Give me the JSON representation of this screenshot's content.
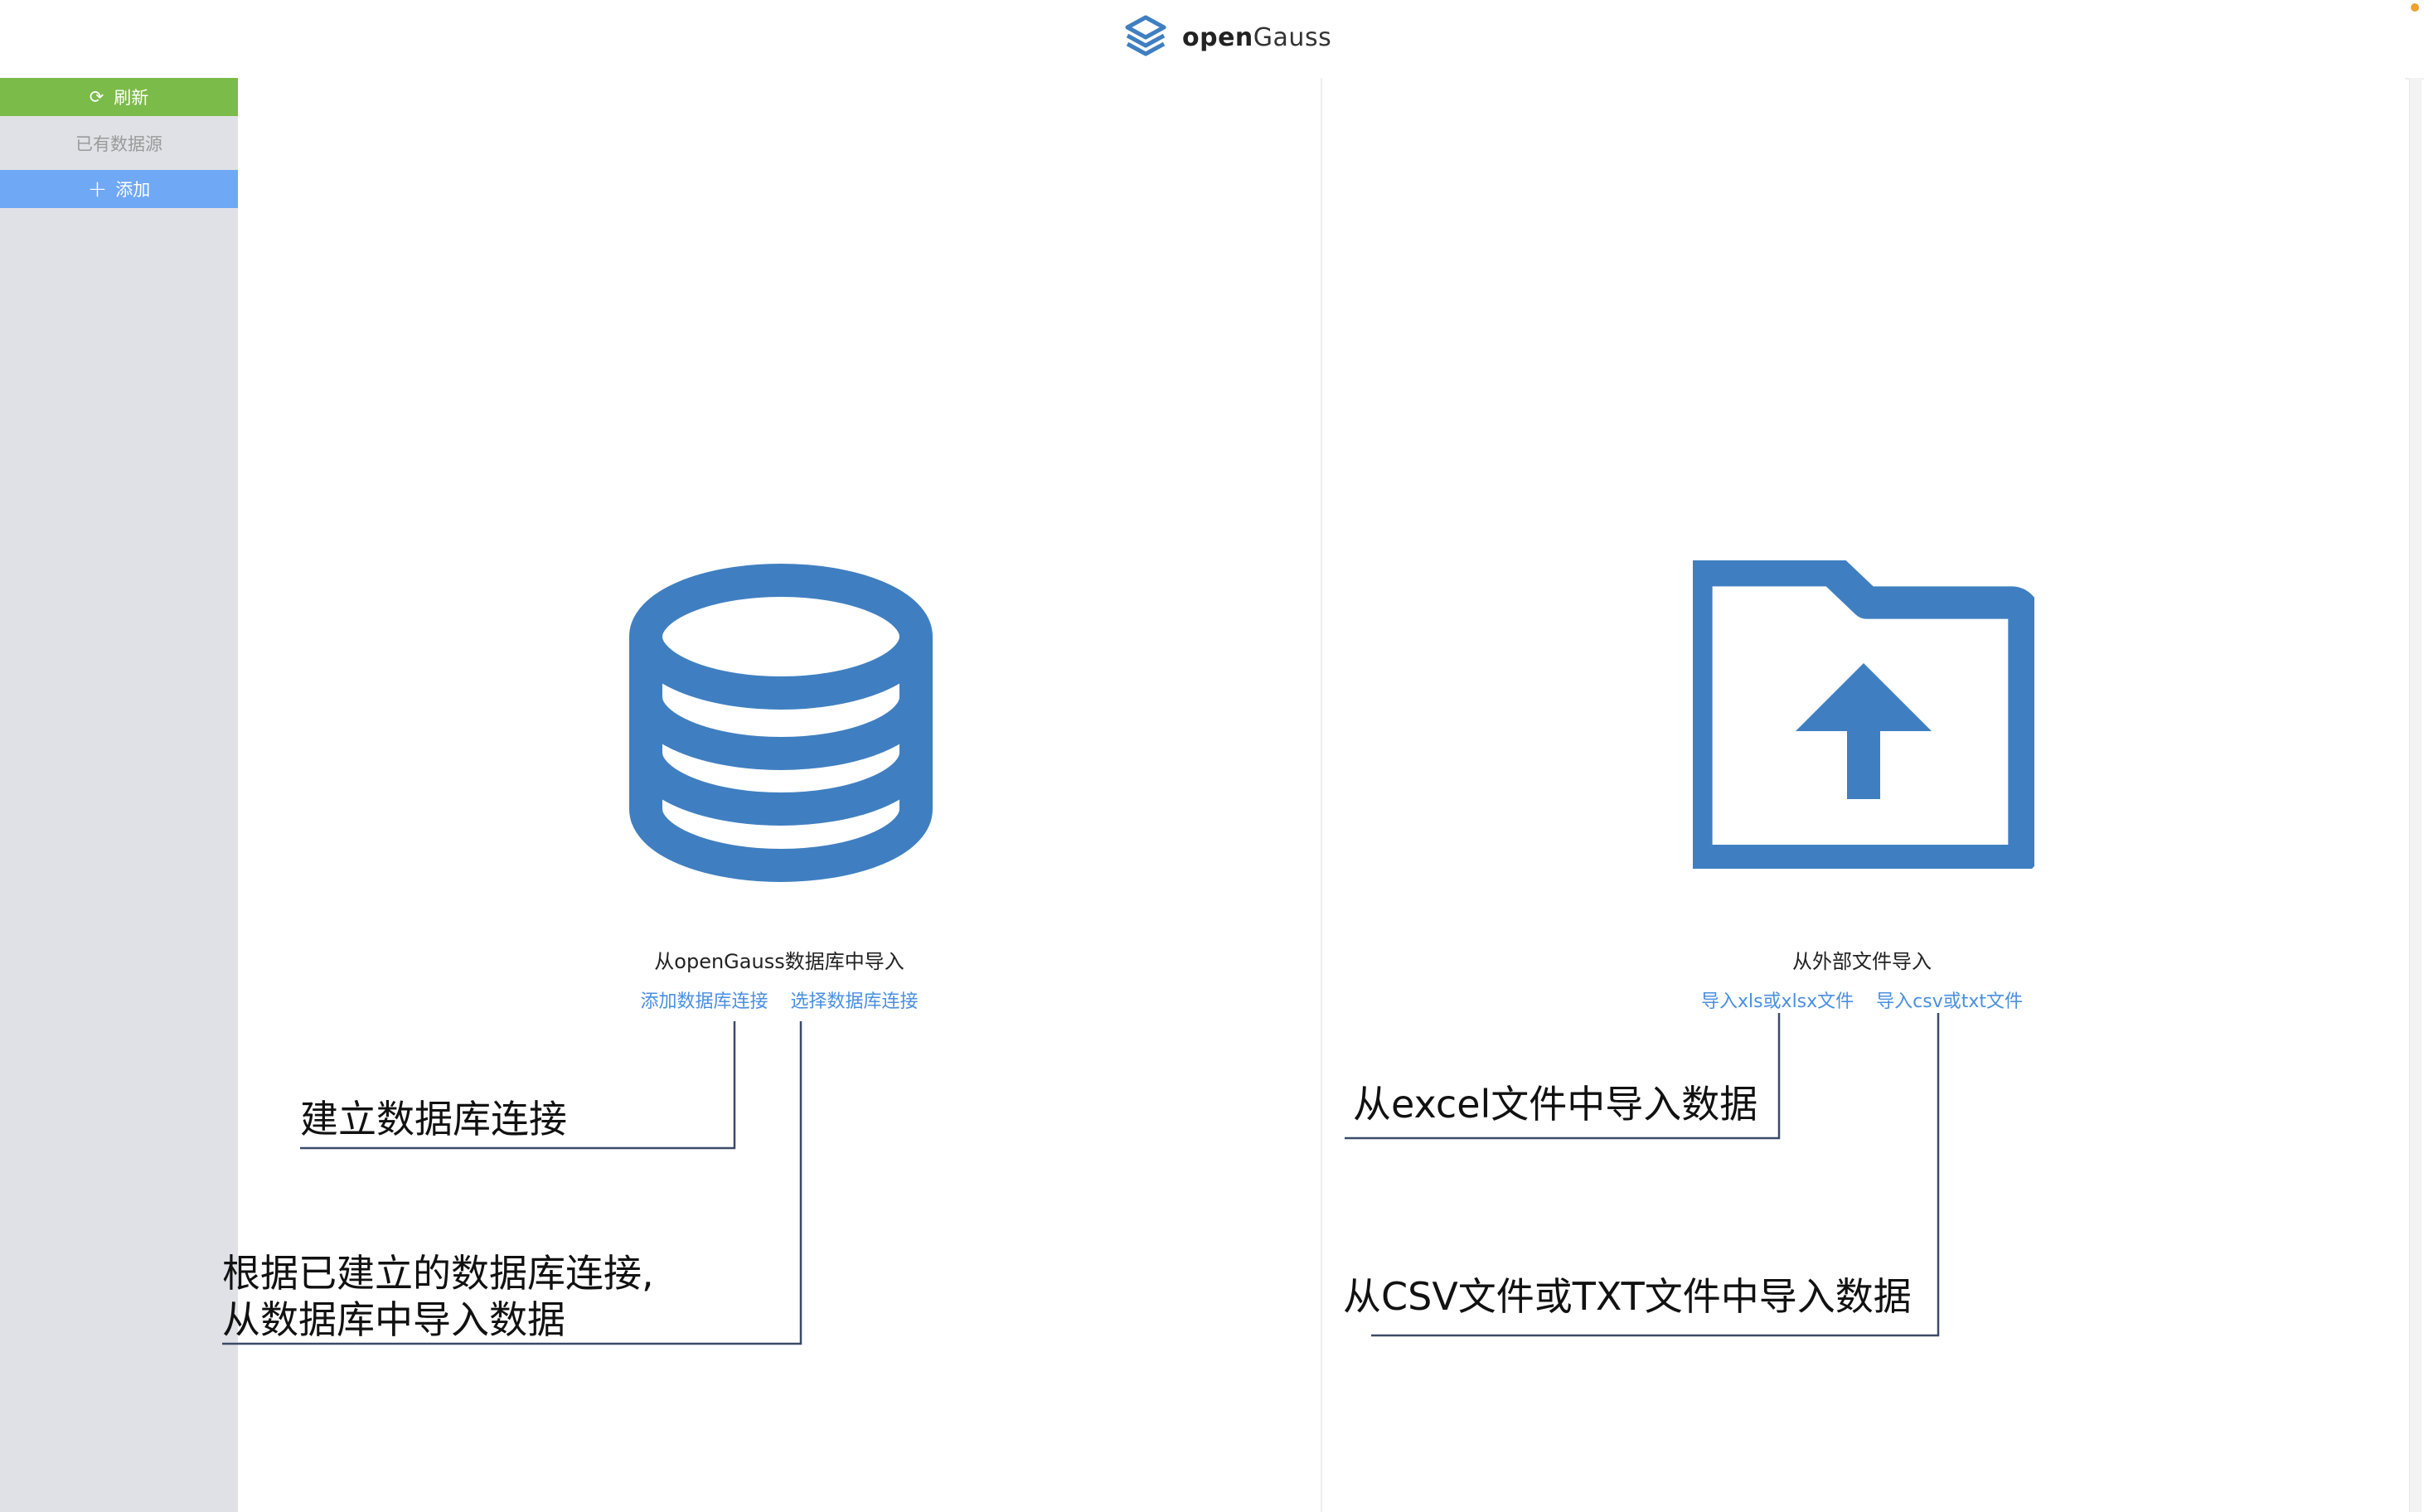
{
  "header": {
    "logo_prefix": "open",
    "logo_suffix": "Gauss",
    "logo_icon": "opengauss-logo-icon"
  },
  "sidebar": {
    "refresh_label": "刷新",
    "refresh_icon": "refresh-icon",
    "existing_label": "已有数据源",
    "add_label": "添加",
    "add_icon": "plus-icon"
  },
  "left_panel": {
    "icon": "database-icon",
    "title": "从openGauss数据库中导入",
    "links": [
      "添加数据库连接",
      "选择数据库连接"
    ]
  },
  "right_panel": {
    "icon": "folder-upload-icon",
    "title": "从外部文件导入",
    "links": [
      "导入xls或xlsx文件",
      "导入csv或txt文件"
    ]
  },
  "annotations": {
    "create_connection": "建立数据库连接",
    "from_connection_line1": "根据已建立的数据库连接,",
    "from_connection_line2": "从数据库中导入数据",
    "from_excel": "从excel文件中导入数据",
    "from_csv_txt": "从CSV文件或TXT文件中导入数据"
  },
  "colors": {
    "accent": "#3f7fc1",
    "refresh_bg": "#7bbb4a",
    "add_bg": "#6fa8f4",
    "link": "#4a8fe0",
    "sidebar_bg": "#e0e1e6"
  }
}
